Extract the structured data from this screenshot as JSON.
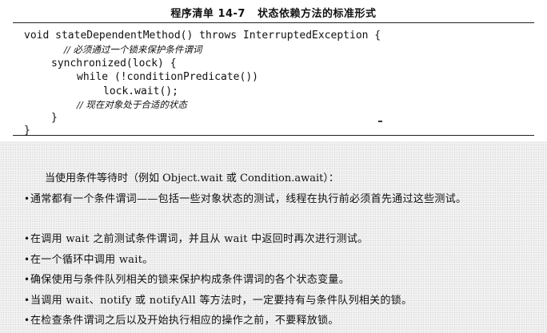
{
  "listing_title": "程序清单 14-7   状态依赖方法的标准形式",
  "code_lines": [
    "void stateDependentMethod() throws InterruptedException {",
    "// 必须通过一个锁来保护条件谓词",
    "synchronized(lock) {",
    "while (!conditionPredicate())",
    "lock.wait();",
    "// 现在对象处于合适的状态",
    "}",
    "}"
  ],
  "intro_text": "当使用条件等待时（例如 Object.wait 或 Condition.await）：",
  "bullet_symbol": "•",
  "bullets": [
    "通常都有一个条件谓词——包括一些对象状态的测试，线程在执行前必须首先通过这些测试。",
    "在调用 wait 之前测试条件谓词，并且从 wait 中返回时再次进行测试。",
    "在一个循环中调用 wait。",
    "确保使用与条件队列相关的锁来保护构成条件谓词的各个状态变量。",
    "当调用 wait、notify 或 notifyAll 等方法时，一定要持有与条件队列相关的锁。",
    "在检查条件谓词之后以及开始执行相应的操作之前，不要释放锁。"
  ]
}
